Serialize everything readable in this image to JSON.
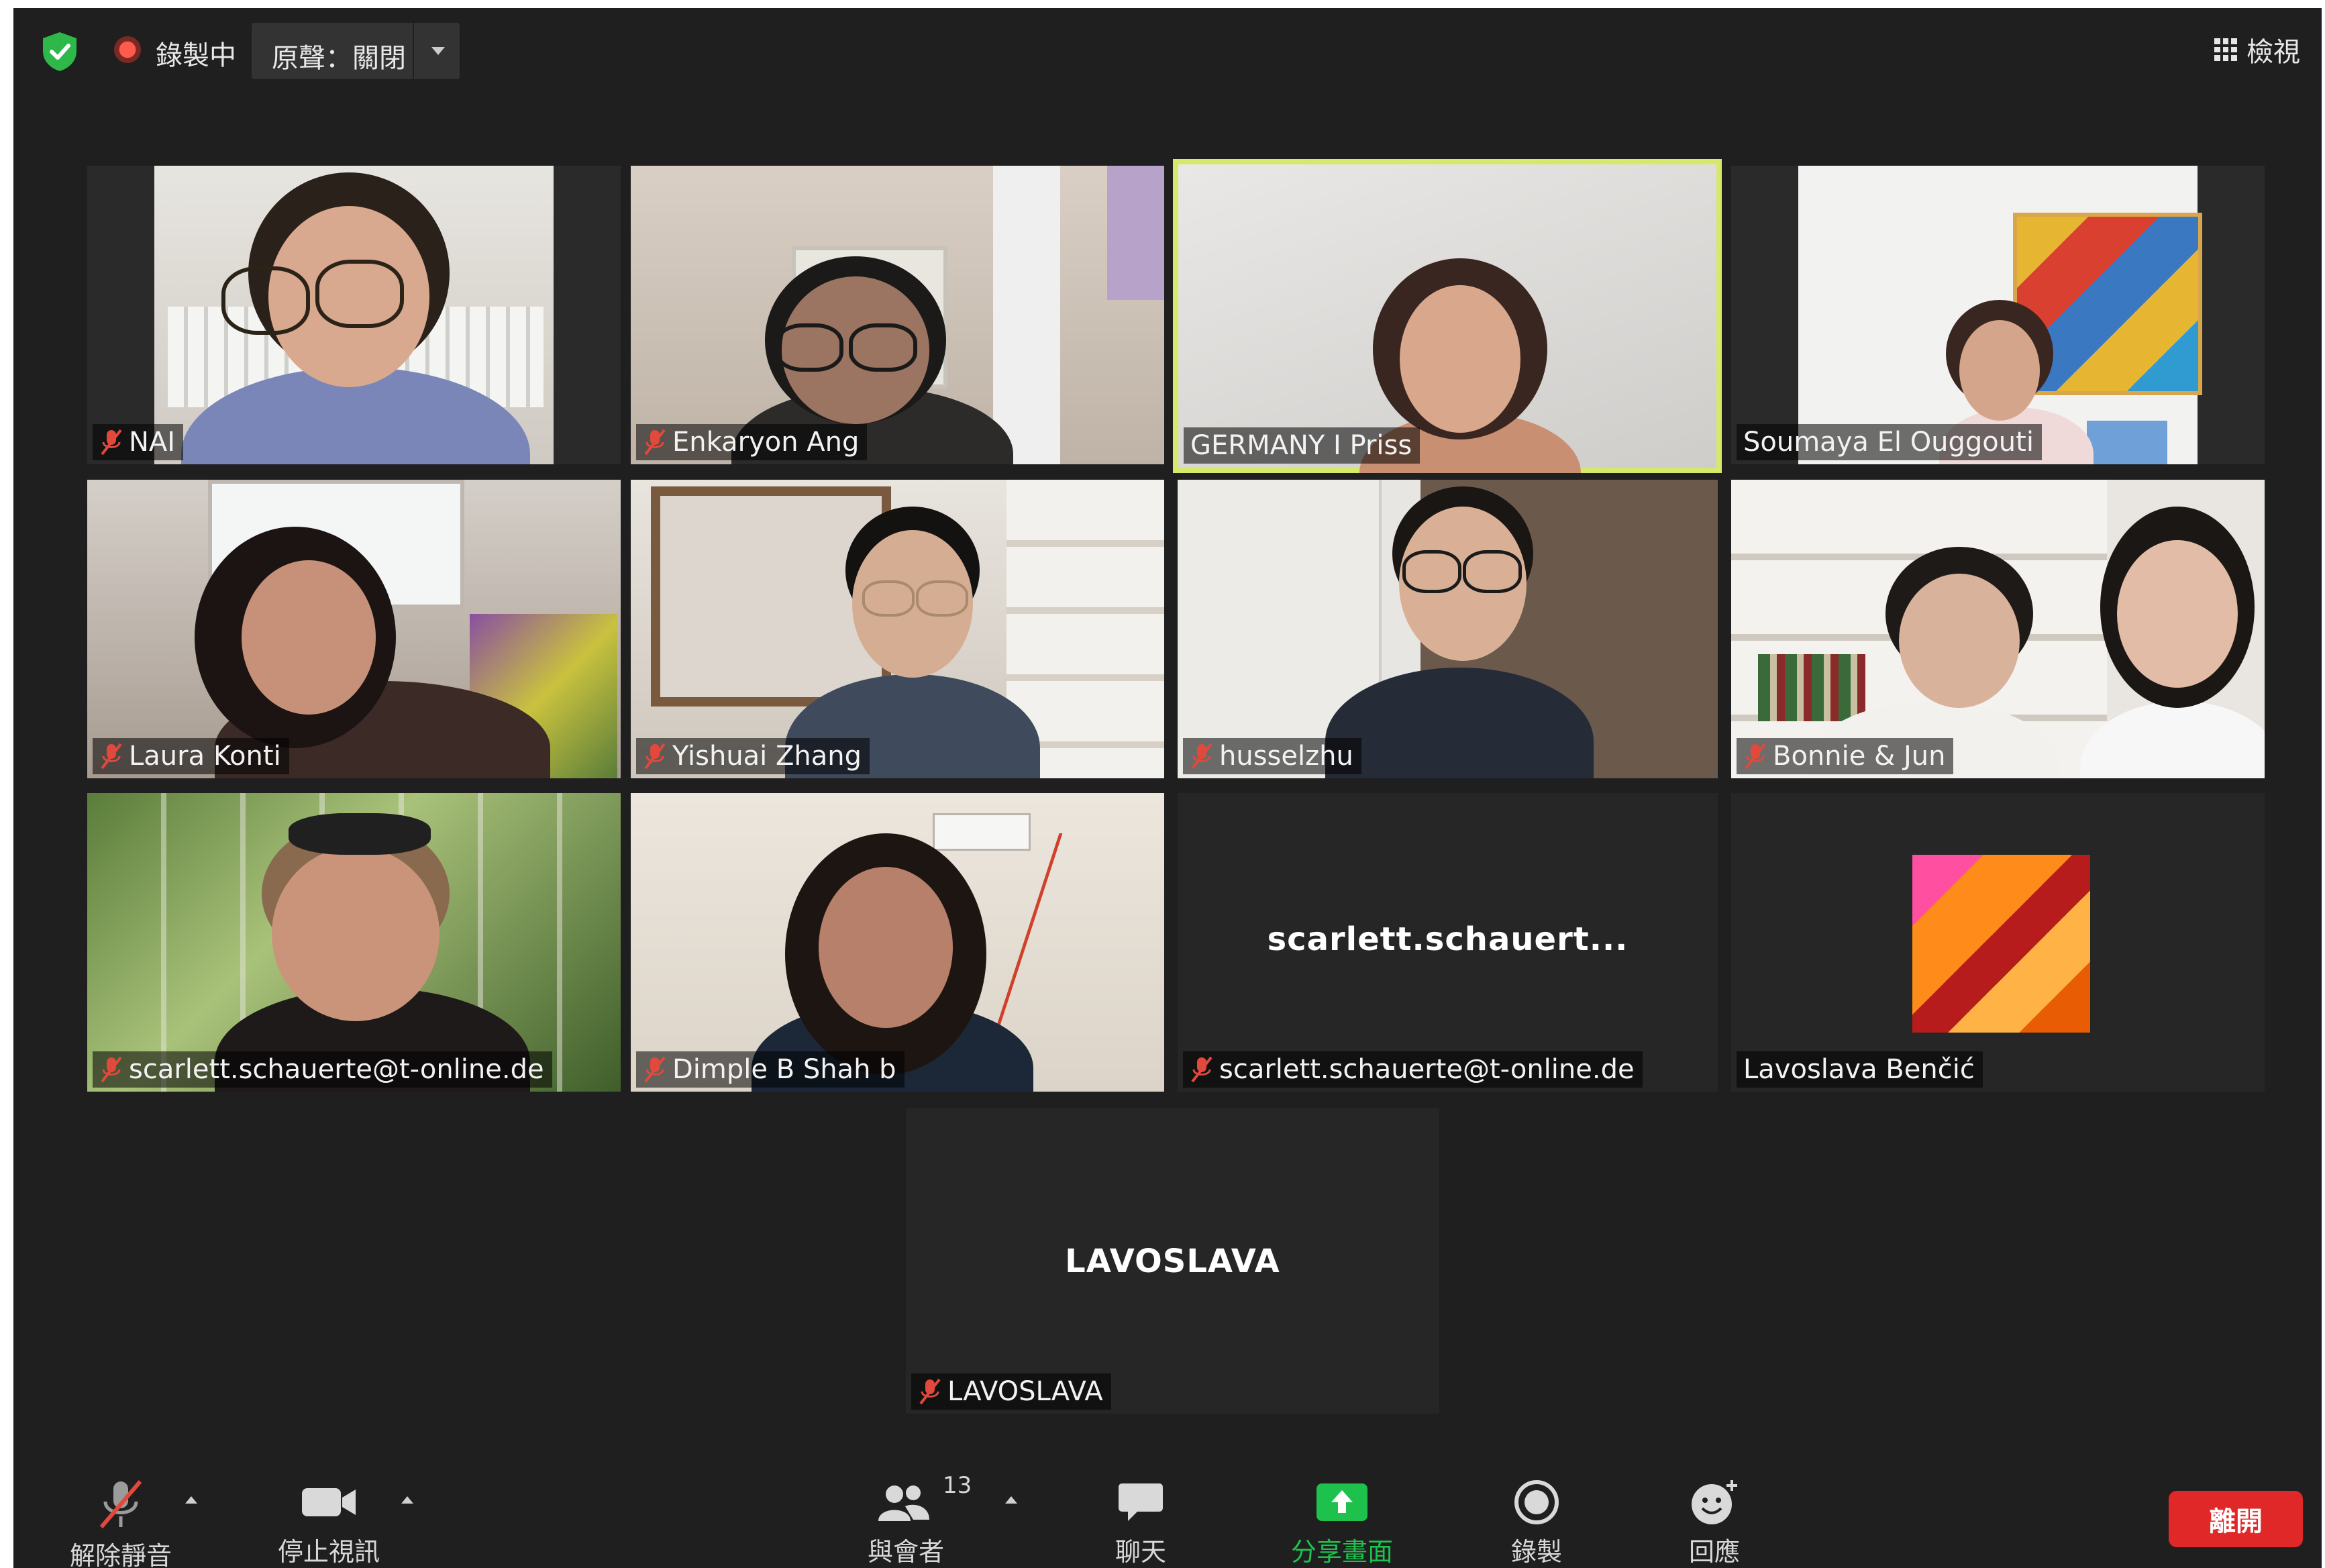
{
  "topbar": {
    "recording_label": "錄製中",
    "original_sound_label": "原聲：關閉",
    "view_label": "檢視"
  },
  "participants": [
    {
      "name": "NAI",
      "muted": true
    },
    {
      "name": "Enkaryon Ang",
      "muted": true
    },
    {
      "name": "GERMANY I Priss",
      "muted": false,
      "active_speaker": true
    },
    {
      "name": "Soumaya El Ouggouti",
      "muted": false
    },
    {
      "name": "Laura Konti",
      "muted": true
    },
    {
      "name": "Yishuai Zhang",
      "muted": true
    },
    {
      "name": "husselzhu",
      "muted": true
    },
    {
      "name": "Bonnie & Jun",
      "muted": true
    },
    {
      "name": "scarlett.schauerte@t-online.de",
      "muted": true
    },
    {
      "name": "Dimple B Shah b",
      "muted": true
    },
    {
      "name": "scarlett.schauerte@t-online.de",
      "muted": true,
      "display_text": "scarlett.schauert..."
    },
    {
      "name": "Lavoslava Benčić",
      "muted": false
    },
    {
      "name": "LAVOSLAVA",
      "muted": true,
      "display_text": "LAVOSLAVA"
    }
  ],
  "toolbar": {
    "unmute_label": "解除靜音",
    "stop_video_label": "停止視訊",
    "participants_label": "與會者",
    "participants_count": "13",
    "chat_label": "聊天",
    "share_label": "分享畫面",
    "record_label": "錄製",
    "reactions_label": "回應",
    "leave_label": "離開"
  },
  "colors": {
    "background": "#1f1f1f",
    "active_speaker_border": "#d7e86a",
    "share_green": "#1fc14d",
    "leave_red": "#e02828",
    "muted_red": "#e0493c"
  }
}
